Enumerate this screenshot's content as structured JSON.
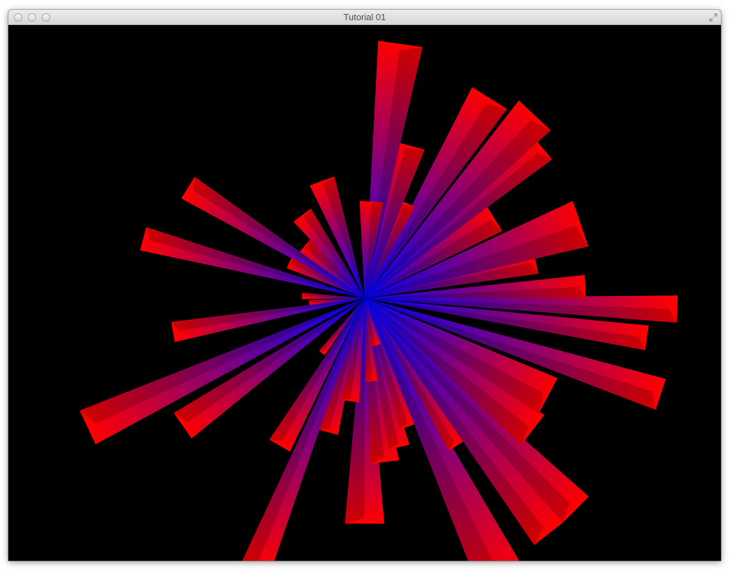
{
  "window": {
    "title": "Tutorial 01"
  },
  "titlebar_controls": {
    "close_icon": "close-icon",
    "minimize_icon": "minimize-icon",
    "zoom_icon": "zoom-icon",
    "fullscreen_icon": "fullscreen-icon"
  },
  "scene": {
    "background_color": "#000000",
    "center_color": "#0000ff",
    "tip_color": "#ff0000",
    "rays": [
      {
        "angle": 90
      },
      {
        "angle": 83
      },
      {
        "angle": 77
      },
      {
        "angle": 71
      },
      {
        "angle": 64
      },
      {
        "angle": 58
      },
      {
        "angle": 52
      },
      {
        "angle": 45
      },
      {
        "angle": 38
      },
      {
        "angle": 28
      },
      {
        "angle": 18
      },
      {
        "angle": 8
      },
      {
        "angle": 2
      },
      {
        "angle": -3
      },
      {
        "angle": -12
      },
      {
        "angle": -19
      },
      {
        "angle": -32
      },
      {
        "angle": -40
      },
      {
        "angle": -47
      },
      {
        "angle": -58
      },
      {
        "angle": -67
      },
      {
        "angle": -75
      },
      {
        "angle": -82
      },
      {
        "angle": -86
      },
      {
        "angle": -110
      },
      {
        "angle": -127
      },
      {
        "angle": -140
      },
      {
        "angle": -148
      },
      {
        "angle": -155
      },
      {
        "angle": -165
      },
      {
        "angle": -178
      },
      {
        "angle": -185
      },
      {
        "angle": -190
      },
      {
        "angle": -205
      },
      {
        "angle": -215
      },
      {
        "angle": -232
      },
      {
        "angle": -240
      },
      {
        "angle": -248
      },
      {
        "angle": -255
      },
      {
        "angle": -262
      },
      {
        "angle": -275
      },
      {
        "angle": -283
      }
    ]
  }
}
